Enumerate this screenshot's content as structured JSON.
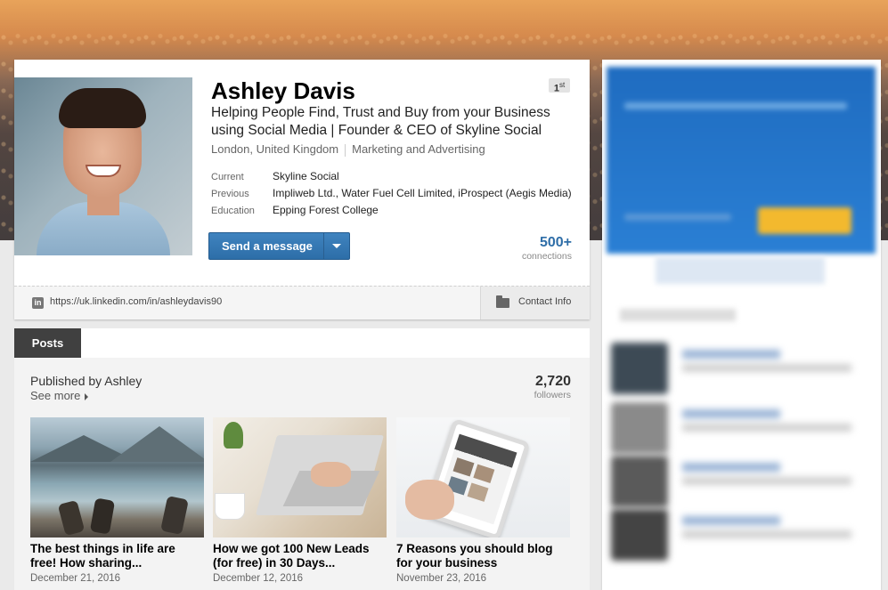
{
  "profile": {
    "name": "Ashley Davis",
    "degree": "1",
    "degree_suffix": "st",
    "headline": "Helping People Find, Trust and Buy from your Business using Social Media | Founder & CEO of Skyline Social",
    "location": "London, United Kingdom",
    "industry": "Marketing and Advertising",
    "details": [
      {
        "label": "Current",
        "value": "Skyline Social"
      },
      {
        "label": "Previous",
        "value": "Impliweb Ltd., Water Fuel Cell Limited, iProspect (Aegis Media)"
      },
      {
        "label": "Education",
        "value": "Epping Forest College"
      }
    ],
    "send_message_label": "Send a message",
    "connections_count": "500+",
    "connections_label": "connections",
    "url": "https://uk.linkedin.com/in/ashleydavis90",
    "contact_info_label": "Contact Info",
    "linkedin_icon_text": "in"
  },
  "posts": {
    "tab_label": "Posts",
    "published_by": "Published by Ashley",
    "see_more": "See more",
    "followers_count": "2,720",
    "followers_label": "followers",
    "items": [
      {
        "title": "The best things in life are free! How sharing...",
        "date": "December 21, 2016"
      },
      {
        "title": "How we got 100 New Leads (for free) in 30 Days...",
        "date": "December 12, 2016"
      },
      {
        "title": "7 Reasons you should blog for your business",
        "date": "November 23, 2016"
      }
    ]
  },
  "colors": {
    "primary_blue": "#2f6ea8",
    "tab_dark": "#404040",
    "ad_blue": "#1f6cc0"
  }
}
